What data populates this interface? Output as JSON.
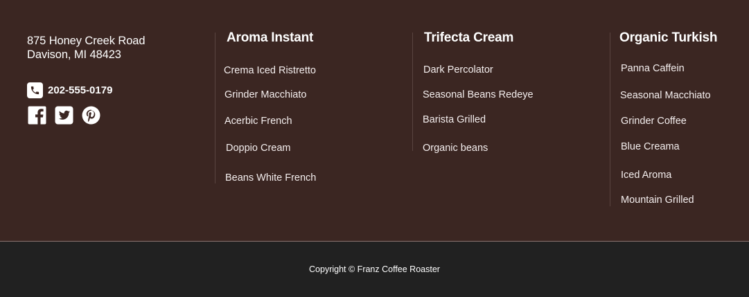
{
  "contact": {
    "address_line1": "875 Honey Creek Road",
    "address_line2": "Davison, MI 48423",
    "phone": "202-555-0179",
    "icons": [
      "phone-icon",
      "facebook-icon",
      "twitter-icon",
      "pinterest-icon"
    ]
  },
  "columns": [
    {
      "title": "Aroma Instant",
      "links": [
        "Crema Iced Ristretto",
        "Grinder Macchiato",
        "Acerbic French",
        "Doppio Cream",
        "Beans White French"
      ]
    },
    {
      "title": "Trifecta Cream",
      "links": [
        "Dark Percolator",
        "Seasonal Beans Redeye",
        "Barista Grilled",
        "Organic beans"
      ]
    },
    {
      "title": "Organic Turkish",
      "links": [
        "Panna Caffein",
        "Seasonal Macchiato",
        "Grinder Coffee",
        "Blue Creama",
        "Iced Aroma",
        "Mountain Grilled"
      ]
    }
  ],
  "copyright": "Copyright © Franz Coffee Roaster",
  "colors": {
    "footer_background": "#3b2622",
    "bottom_bar_background": "#212121",
    "text": "#ffffff"
  }
}
